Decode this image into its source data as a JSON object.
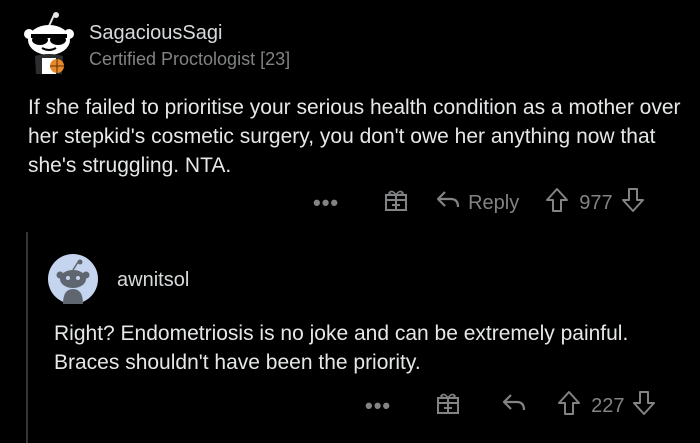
{
  "comment": {
    "author": "SagaciousSagi",
    "flair": "Certified Proctologist [23]",
    "body": "If she failed to prioritise your serious health condition as a mother over her stepkid's cosmetic surgery, you don't owe her anything now that she's struggling. NTA.",
    "more_label": "•••",
    "award_icon": "gift-icon",
    "reply_label": "Reply",
    "score": "977"
  },
  "reply": {
    "author": "awnitsol",
    "body": "Right? Endometriosis is no joke and can be extremely painful. Braces shouldn't have been the priority.",
    "more_label": "•••",
    "award_icon": "gift-icon",
    "score": "227"
  },
  "colors": {
    "background": "#000000",
    "text": "#d7dadc",
    "muted": "#818384",
    "thread_line": "#343536",
    "avatar_bg": "#c5d4ef"
  }
}
